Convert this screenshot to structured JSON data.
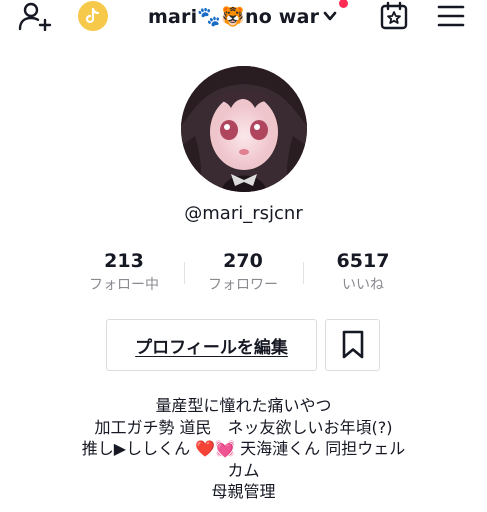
{
  "header": {
    "title": "mari🐾🐯no war",
    "icons": {
      "add_user": "add-user-icon",
      "coin": "tiktok-coin-icon",
      "dropdown": "chevron-down-icon",
      "calendar": "calendar-star-icon",
      "menu": "hamburger-menu-icon"
    },
    "notification_color": "#fe2c55"
  },
  "profile": {
    "username": "@mari_rsjcnr",
    "avatar": "avatar-image"
  },
  "stats": [
    {
      "value": "213",
      "label": "フォロー中"
    },
    {
      "value": "270",
      "label": "フォロワー"
    },
    {
      "value": "6517",
      "label": "いいね"
    }
  ],
  "actions": {
    "edit_profile_label": "プロフィールを編集",
    "bookmark_icon": "bookmark-icon"
  },
  "bio": {
    "lines": [
      "量産型に憧れた痛いやつ",
      "加工ガチ勢 道民　ネッ友欲しいお年頃(?)",
      "推し▶ししくん ❤️💓 天海漣くん 同担ウェル",
      "カム",
      "母親管理"
    ]
  }
}
